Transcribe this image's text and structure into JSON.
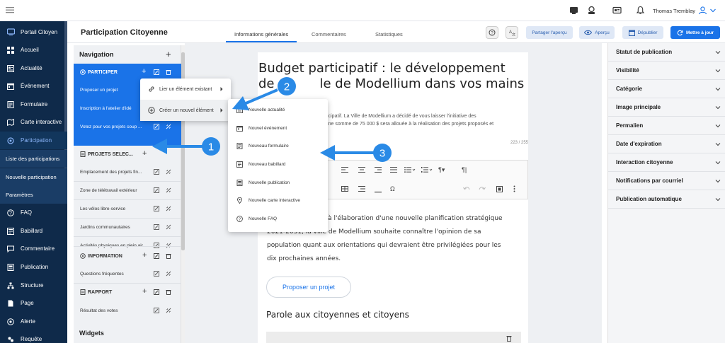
{
  "topbar": {
    "user_name": "Thomas Tremblay"
  },
  "sidebar": {
    "items": [
      {
        "label": "Portail Citoyen",
        "icon": "monitor-icon",
        "active": false
      },
      {
        "label": "Accueil",
        "icon": "grid-icon"
      },
      {
        "label": "Actualité",
        "icon": "news-icon"
      },
      {
        "label": "Événement",
        "icon": "calendar-icon"
      },
      {
        "label": "Formulaire",
        "icon": "form-icon"
      },
      {
        "label": "Carte interactive",
        "icon": "map-icon"
      },
      {
        "label": "Participation",
        "icon": "participation-icon",
        "active": true
      }
    ],
    "subitems": [
      {
        "label": "Liste des participations"
      },
      {
        "label": "Nouvelle participation"
      },
      {
        "label": "Paramètres"
      }
    ],
    "items_bottom": [
      {
        "label": "FAQ",
        "icon": "question-icon"
      },
      {
        "label": "Babillard",
        "icon": "board-icon"
      },
      {
        "label": "Commentaire",
        "icon": "comment-icon"
      },
      {
        "label": "Publication",
        "icon": "publication-icon"
      },
      {
        "label": "Structure",
        "icon": "structure-icon"
      },
      {
        "label": "Page",
        "icon": "page-icon"
      },
      {
        "label": "Alerte",
        "icon": "alert-icon"
      },
      {
        "label": "Requête",
        "icon": "request-icon"
      }
    ]
  },
  "header": {
    "title": "Participation Citoyenne",
    "tabs": [
      {
        "label": "Informations générales",
        "active": true
      },
      {
        "label": "Commentaires"
      },
      {
        "label": "Statistiques"
      }
    ],
    "buttons": {
      "share": "Partager l'aperçu",
      "preview": "Aperçu",
      "unpublish": "Dépublier",
      "update": "Mettre à jour"
    }
  },
  "navigation": {
    "title": "Navigation",
    "participer": {
      "label": "PARTICIPER",
      "items": [
        "Proposer un projet",
        "Inscription à l'atelier d'idé",
        "Votez pour vos projets coup ..."
      ]
    },
    "projets": {
      "label": "PROJETS SÉLEC...",
      "items": [
        "Emplacement des projets fin...",
        "Zone de télétravail extérieur",
        "Les vélos libre-service",
        "Jardins communautaires",
        "Activités physiques en plein air"
      ]
    },
    "information": {
      "label": "INFORMATION",
      "items": [
        "Questions fréquentes"
      ]
    },
    "rapport": {
      "label": "RAPPORT",
      "items": [
        "Résultat des votes"
      ]
    },
    "widgets": "Widgets"
  },
  "context_menu": {
    "items": [
      {
        "label": "Lier un élément existant",
        "icon": "link-icon"
      },
      {
        "label": "Créer un nouvel élément",
        "icon": "plus-circle-icon"
      }
    ],
    "submenu": [
      {
        "label": "Nouvelle actualité",
        "icon": "news-icon"
      },
      {
        "label": "Nouvel événement",
        "icon": "calendar-icon"
      },
      {
        "label": "Nouveau formulaire",
        "icon": "form-icon"
      },
      {
        "label": "Nouveau babillard",
        "icon": "board-icon"
      },
      {
        "label": "Nouvelle publication",
        "icon": "publication-icon"
      },
      {
        "label": "Nouvelle carte interactive",
        "icon": "map-pin-icon"
      },
      {
        "label": "Nouvelle FAQ",
        "icon": "question-icon"
      }
    ]
  },
  "editor": {
    "title_line1": "Budget participatif : le développement",
    "title_line2": "de",
    "title_line2_end": "le de Modellium dans vos mains",
    "intro_line1": "participatif. La Ville de Modellium a décidé de vous laisser l'initiative des",
    "intro_line2": "er, une somme de 75 000 $ sera allouée à la réalisation des projets proposés et",
    "char_count": "223 / 255",
    "body_line1": "ffaire à l'élaboration d'une nouvelle planification stratégique",
    "body_line2": "2021-2031, la ville de Modellium souhaite connaître l'opinion de sa",
    "body_line3": "population quant aux orientations qui devraient être privilégiées pour les",
    "body_line4": "dix prochaines années.",
    "cta": "Proposer un projet",
    "subheading": "Parole aux citoyennes et citoyens"
  },
  "right_panel": {
    "items": [
      "Statut de publication",
      "Visibilité",
      "Catégorie",
      "Image principale",
      "Permalien",
      "Date d'expiration",
      "Interaction citoyenne",
      "Notifications par courriel",
      "Publication automatique"
    ]
  },
  "callouts": [
    "1",
    "2",
    "3"
  ],
  "colors": {
    "sidebar": "#0f2a4a",
    "accent": "#1a73e8",
    "callout": "#2a8ae6"
  }
}
